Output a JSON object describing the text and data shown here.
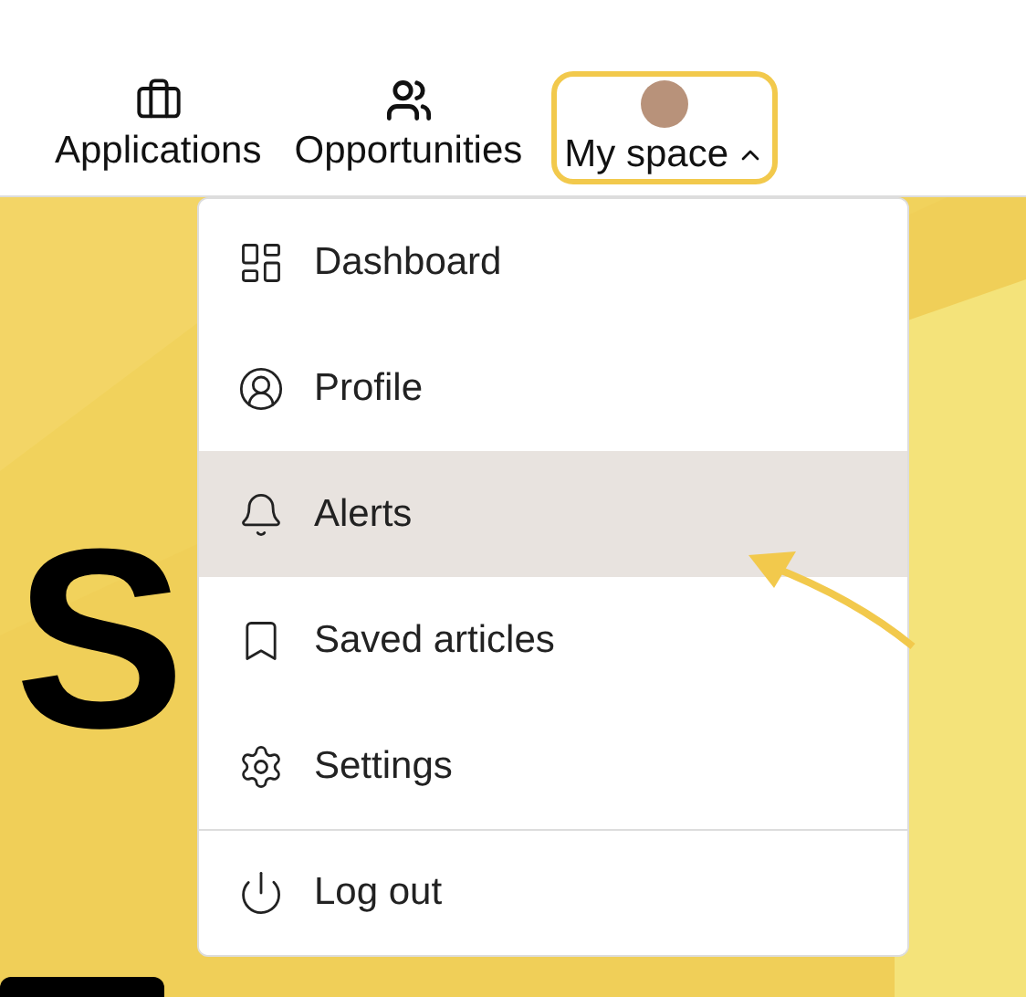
{
  "nav": [
    {
      "label": "Applications",
      "kind": "briefcase",
      "selected": false
    },
    {
      "label": "Opportunities",
      "kind": "people",
      "selected": false
    },
    {
      "label": "My space",
      "kind": "avatar",
      "selected": true,
      "expanded": true
    }
  ],
  "hero": {
    "heading": "S"
  },
  "menu": [
    {
      "label": "Dashboard",
      "kind": "dashboard",
      "selected": false
    },
    {
      "label": "Profile",
      "kind": "profile",
      "selected": false
    },
    {
      "label": "Alerts",
      "kind": "bell",
      "selected": true
    },
    {
      "label": "Saved articles",
      "kind": "bookmark",
      "selected": false
    },
    {
      "label": "Settings",
      "kind": "gear",
      "selected": false
    },
    {
      "label": "Log out",
      "kind": "power",
      "selected": false
    }
  ]
}
